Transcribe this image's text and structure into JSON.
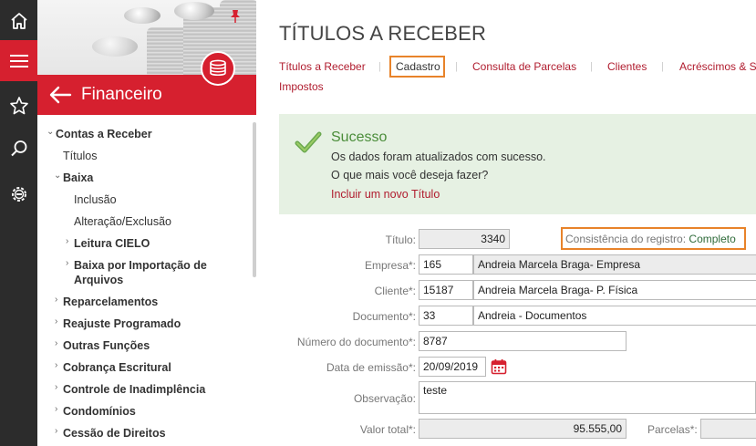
{
  "rail": {
    "icons": [
      "home-icon",
      "hamburger-icon",
      "star-icon",
      "search-icon",
      "settings-icon"
    ]
  },
  "sidebar": {
    "title": "Financeiro",
    "items": [
      {
        "label": "Contas a Receber",
        "bold": true,
        "chevron": "down"
      },
      {
        "label": "Títulos",
        "bold": false
      },
      {
        "label": "Baixa",
        "bold": true,
        "chevron": "down"
      },
      {
        "label": "Inclusão",
        "bold": false
      },
      {
        "label": "Alteração/Exclusão",
        "bold": false
      },
      {
        "label": "Leitura CIELO",
        "bold": true,
        "chevron": "right"
      },
      {
        "label": "Baixa por Importação de",
        "bold": true,
        "chevron": "right"
      },
      {
        "label": "Arquivos",
        "bold": true
      },
      {
        "label": "Reparcelamentos",
        "bold": true,
        "chevron": "right"
      },
      {
        "label": "Reajuste Programado",
        "bold": true,
        "chevron": "right"
      },
      {
        "label": "Outras Funções",
        "bold": true,
        "chevron": "right"
      },
      {
        "label": "Cobrança Escritural",
        "bold": true,
        "chevron": "right"
      },
      {
        "label": "Controle de Inadimplência",
        "bold": true,
        "chevron": "right"
      },
      {
        "label": "Condomínios",
        "bold": true,
        "chevron": "right"
      },
      {
        "label": "Cessão de Direitos",
        "bold": true,
        "chevron": "right"
      }
    ]
  },
  "page": {
    "title": "TÍTULOS A RECEBER",
    "tabs": [
      "Títulos a Receber",
      "Cadastro",
      "Consulta de Parcelas",
      "Clientes",
      "Acréscimos & S",
      "Impostos"
    ]
  },
  "alert": {
    "title": "Sucesso",
    "line1": "Os dados foram atualizados com sucesso.",
    "line2": "O que mais você deseja fazer?",
    "link": "Incluir um novo Título"
  },
  "form": {
    "titulo_label": "Título:",
    "titulo_value": "3340",
    "consistencia_label": "Consistência do registro:",
    "consistencia_value": "Completo",
    "empresa_label": "Empresa*:",
    "empresa_code": "165",
    "empresa_name": "Andreia Marcela Braga- Empresa",
    "cliente_label": "Cliente*:",
    "cliente_code": "15187",
    "cliente_name": "Andreia Marcela Braga- P. Física",
    "documento_label": "Documento*:",
    "documento_code": "33",
    "documento_name": "Andreia - Documentos",
    "numdoc_label": "Número do documento*:",
    "numdoc_value": "8787",
    "emissao_label": "Data de emissão*:",
    "emissao_value": "20/09/2019",
    "obs_label": "Observação:",
    "obs_value": "teste",
    "valor_label": "Valor total*:",
    "valor_value": "95.555,00",
    "parcelas_label": "Parcelas*:",
    "parcelas_value": ""
  },
  "colors": {
    "brand_red": "#d6202f",
    "link_red": "#b01c2e",
    "highlight_orange": "#e8832a",
    "success_green": "#4b8d3a",
    "success_bg": "#e6f1e3"
  }
}
